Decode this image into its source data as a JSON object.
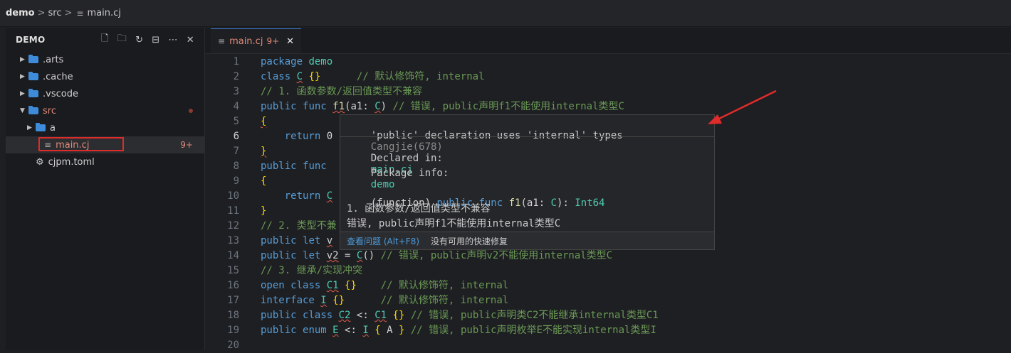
{
  "breadcrumb": {
    "root": "demo",
    "folder": "src",
    "file": "main.cj"
  },
  "sidebar": {
    "title": "DEMO",
    "items": [
      {
        "label": ".arts",
        "indent": 0
      },
      {
        "label": ".cache",
        "indent": 0
      },
      {
        "label": ".vscode",
        "indent": 0
      },
      {
        "label": "src",
        "indent": 0
      },
      {
        "label": "a",
        "indent": 1
      },
      {
        "label": "main.cj",
        "indent": 1,
        "badge": "9+"
      },
      {
        "label": "cjpm.toml",
        "indent": 0
      }
    ]
  },
  "tab": {
    "label": "main.cj",
    "count": "9+"
  },
  "editor": {
    "lines": [
      {
        "n": "1",
        "t": "package demo"
      },
      {
        "n": "2",
        "t": "class C {}      // 默认修饰符, internal"
      },
      {
        "n": "3",
        "t": "// 1. 函数参数/返回值类型不兼容"
      },
      {
        "n": "4",
        "t": "public func f1(a1: C) // 错误, public声明f1不能使用internal类型C"
      },
      {
        "n": "5",
        "t": "{"
      },
      {
        "n": "6",
        "t": "    return 0"
      },
      {
        "n": "7",
        "t": "}"
      },
      {
        "n": "8",
        "t": "public func "
      },
      {
        "n": "9",
        "t": "{"
      },
      {
        "n": "10",
        "t": "    return C"
      },
      {
        "n": "11",
        "t": "}"
      },
      {
        "n": "12",
        "t": "// 2. 类型不兼"
      },
      {
        "n": "13",
        "t": "public let v"
      },
      {
        "n": "14",
        "t": "public let v2 = C() // 错误, public声明v2不能使用internal类型C"
      },
      {
        "n": "15",
        "t": "// 3. 继承/实现冲突"
      },
      {
        "n": "16",
        "t": "open class C1 {}    // 默认修饰符, internal"
      },
      {
        "n": "17",
        "t": "interface I {}      // 默认修饰符, internal"
      },
      {
        "n": "18",
        "t": "public class C2 <: C1 {} // 错误, public声明类C2不能继承internal类型C1"
      },
      {
        "n": "19",
        "t": "public enum E <: I { A } // 错误, public声明枚举E不能实现internal类型I"
      },
      {
        "n": "20",
        "t": ""
      }
    ]
  },
  "hover": {
    "message": "'public' declaration uses 'internal' types",
    "source": "Cangjie(678)",
    "declared_label": "Declared in:",
    "declared_value": "main.cj",
    "package_label": "Package info:",
    "package_value": "demo",
    "signature": "(function) public func f1(a1: C): Int64",
    "doc1": "1. 函数参数/返回值类型不兼容",
    "doc2": "错误, public声明f1不能使用internal类型C",
    "view_problem": "查看问题 (Alt+F8)",
    "no_fix": "没有可用的快速修复"
  },
  "colors": {
    "accent": "#3c7bd6",
    "error": "#e25b4a",
    "annotation": "#e02b2b"
  }
}
